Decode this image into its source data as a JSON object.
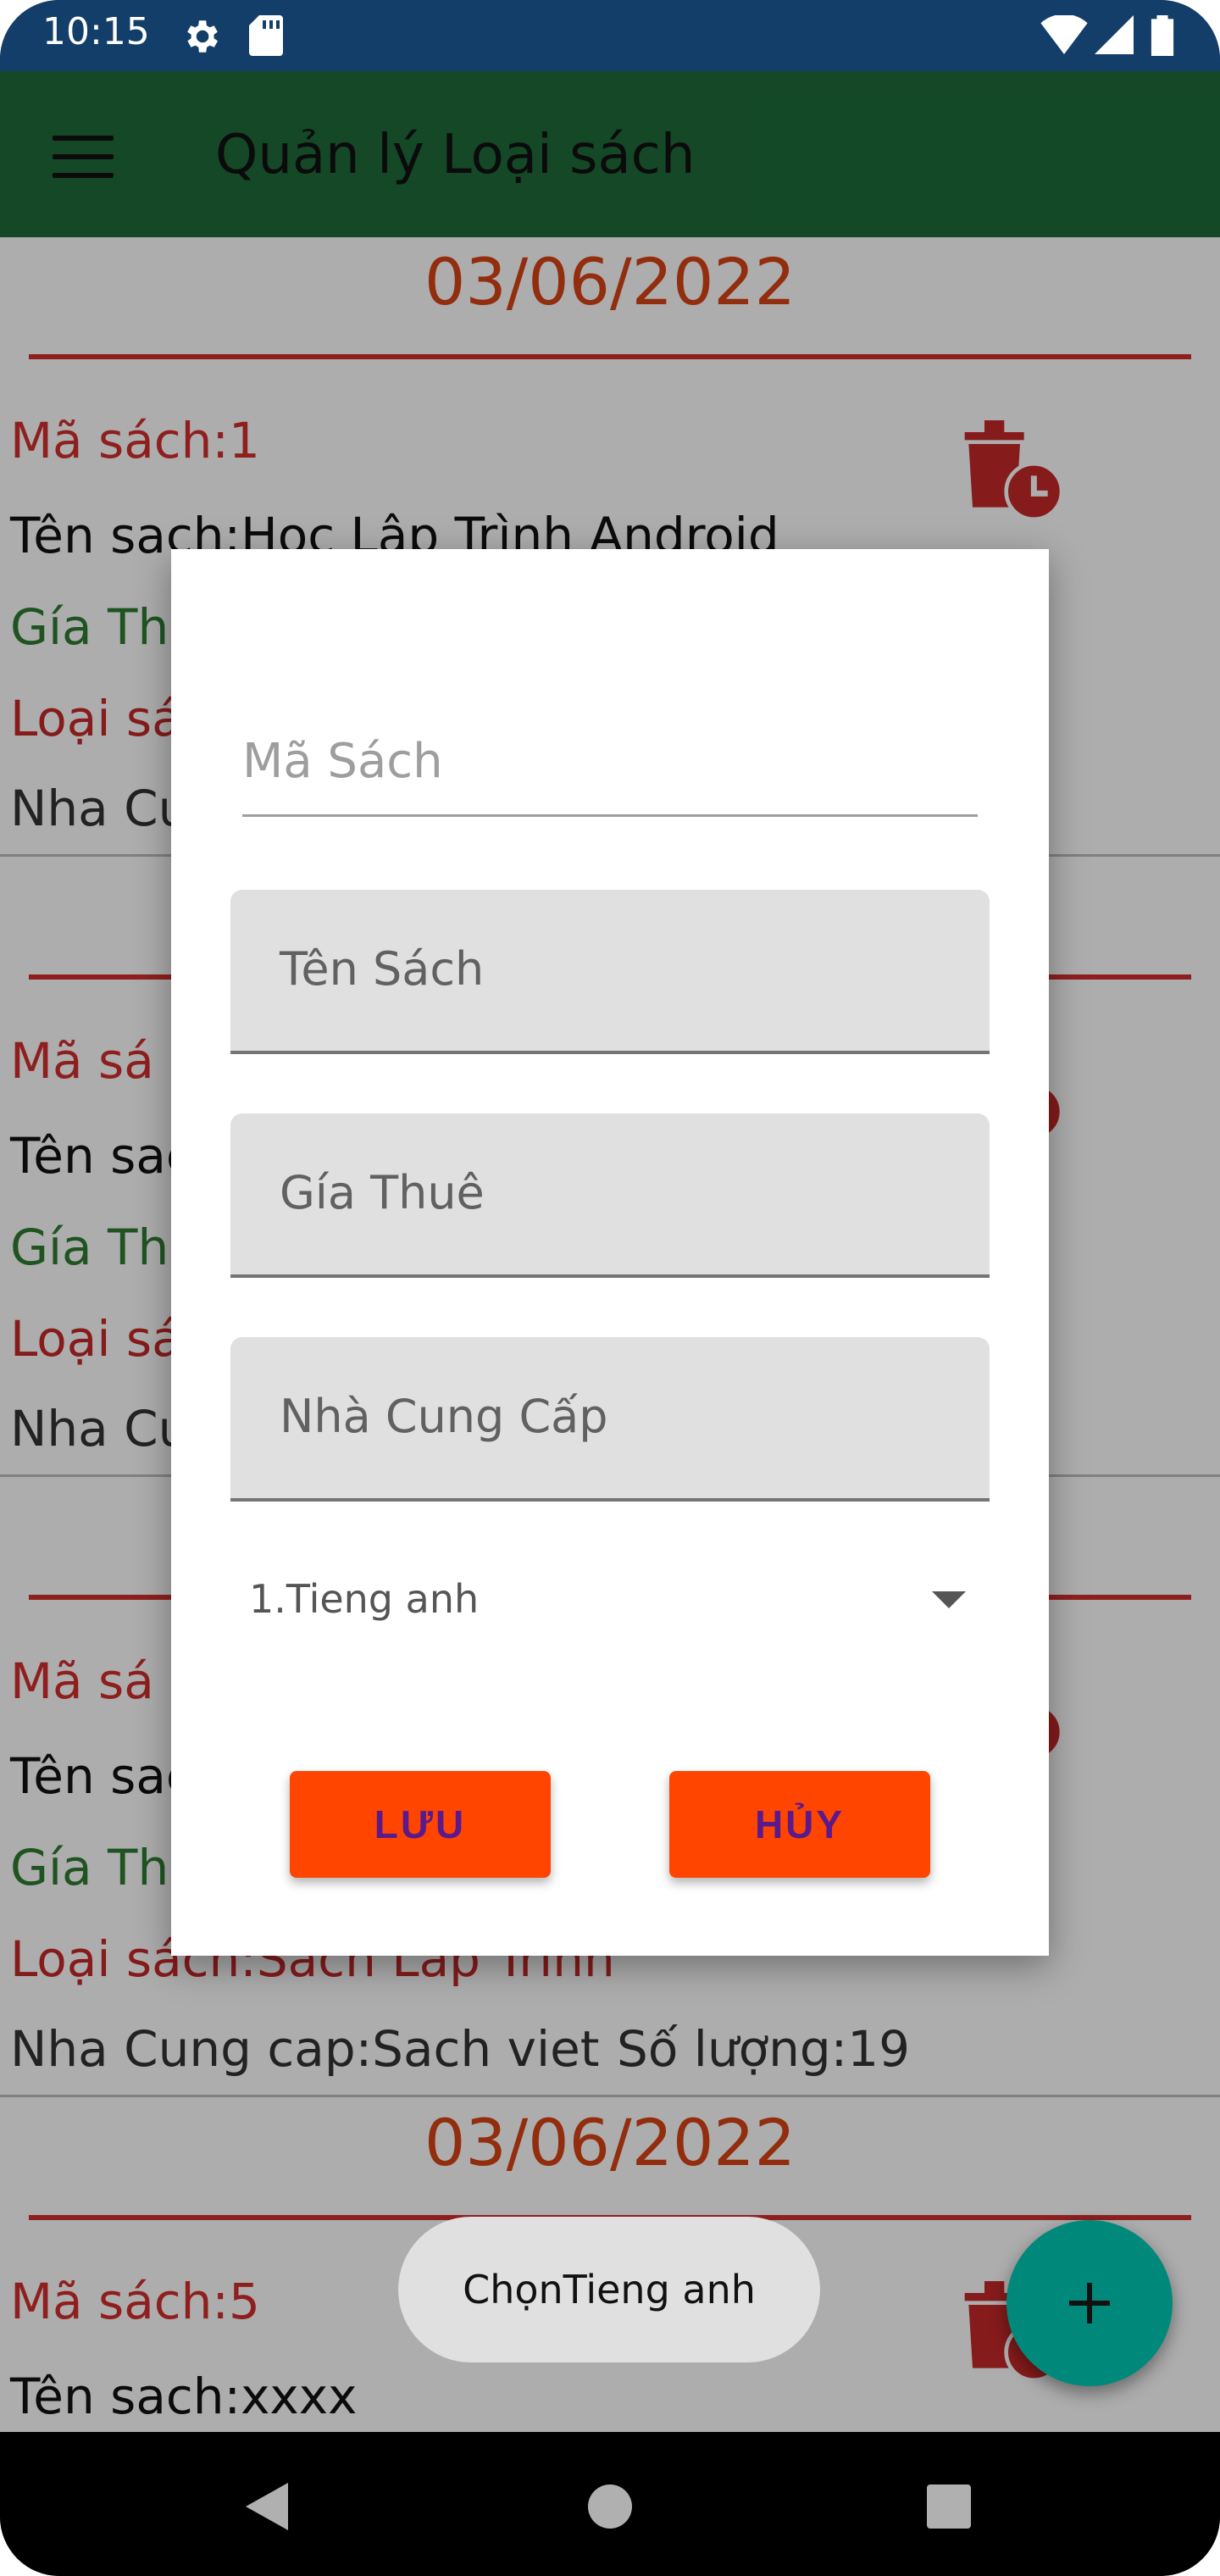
{
  "status_bar": {
    "time": "10:15"
  },
  "app_bar": {
    "title": "Quản lý Loại sách"
  },
  "items": [
    {
      "date": "03/06/2022",
      "ma_sach": "Mã sách:1",
      "ten_sach": "Tên sach:Hoc Lâp Trình Android",
      "gia_thue": "Gía Thu",
      "loai_sach": "Loại sá",
      "nha_cung_cap": "Nha Cu"
    },
    {
      "ma_sach": "Mã sá",
      "ten_sach": "Tên sac",
      "gia_thue": "Gía Thu",
      "loai_sach": "Loại sá",
      "nha_cung_cap": "Nha Cu"
    },
    {
      "ma_sach": "Mã sá",
      "ten_sach": "Tên sac",
      "gia_thue": "Gía Thu",
      "loai_sach": "Loại sách:Sach Lap Trinh",
      "nha_cung_cap": "Nha Cung cap:Sach viet",
      "so_luong": "Số lượng:19"
    },
    {
      "date": "03/06/2022",
      "ma_sach": "Mã sách:5",
      "ten_sach": "Tên sach:xxxx"
    }
  ],
  "dialog": {
    "ma_sach_placeholder": "Mã Sách",
    "ten_sach_placeholder": "Tên Sách",
    "gia_thue_placeholder": "Gía Thuê",
    "nha_cung_cap_placeholder": "Nhà Cung Cấp",
    "spinner_value": "1.Tieng anh",
    "save_label": "LƯU",
    "cancel_label": "HỦY"
  },
  "toast": {
    "text": "ChọnTieng anh"
  },
  "colors": {
    "status_bar": "#123e69",
    "app_bar": "#1e6b3a",
    "accent_red": "#d32f2f",
    "button": "#ff4500",
    "button_text": "#5b1a8c",
    "fab": "#00897b"
  },
  "icons": {
    "menu": "menu-icon",
    "delete": "delete-clock-icon",
    "fab": "plus-icon"
  }
}
